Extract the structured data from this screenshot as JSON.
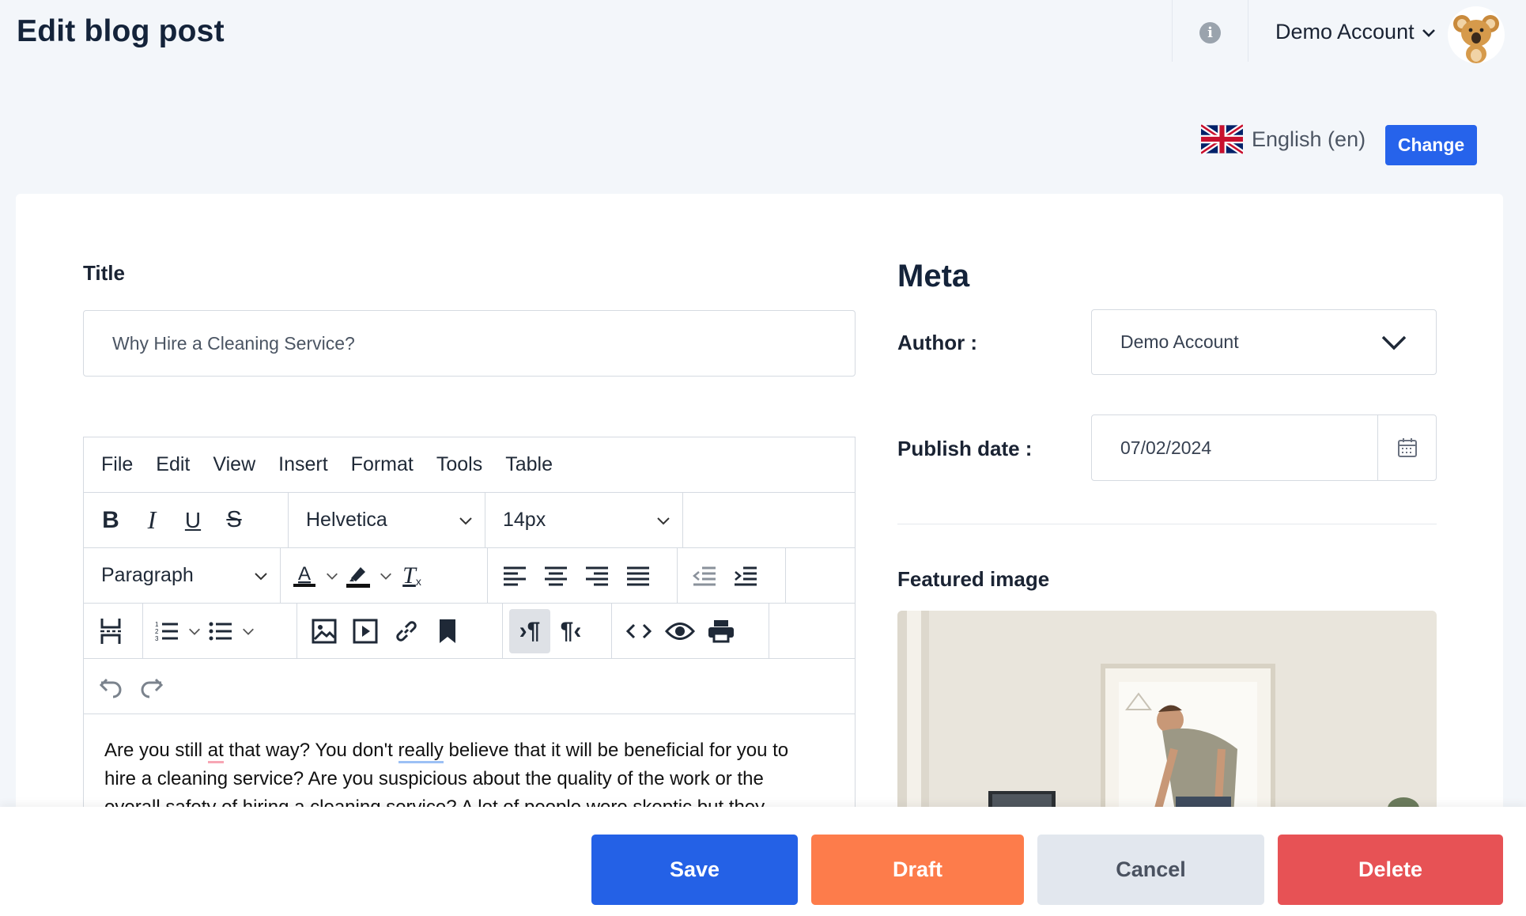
{
  "header": {
    "page_title": "Edit blog post",
    "account_name": "Demo Account"
  },
  "language": {
    "label": "English (en)",
    "change_label": "Change"
  },
  "form": {
    "title_label": "Title",
    "title_value": "Why Hire a Cleaning Service?"
  },
  "editor": {
    "menu": [
      "File",
      "Edit",
      "View",
      "Insert",
      "Format",
      "Tools",
      "Table"
    ],
    "font_family": "Helvetica",
    "font_size": "14px",
    "block_format": "Paragraph",
    "content_line1_a": "Are you still ",
    "content_line1_b": "at",
    "content_line1_c": " that way? You don't ",
    "content_line1_d": "really",
    "content_line1_e": " believe that it will be beneficial for you to",
    "content_line2": "hire a cleaning service? Are you suspicious about the quality of the work or the",
    "content_line3": "overall safety of hiring a cleaning service? A lot of people were skeptic but they"
  },
  "meta": {
    "heading": "Meta",
    "author_label": "Author :",
    "author_value": "Demo Account",
    "publish_label": "Publish date :",
    "publish_value": "07/02/2024",
    "featured_label": "Featured image"
  },
  "footer": {
    "save": "Save",
    "draft": "Draft",
    "cancel": "Cancel",
    "delete": "Delete"
  },
  "colors": {
    "primary": "#2461e6",
    "draft": "#fd7c4b",
    "cancel": "#e2e7ee",
    "delete": "#e75255",
    "background": "#f3f6fa"
  }
}
